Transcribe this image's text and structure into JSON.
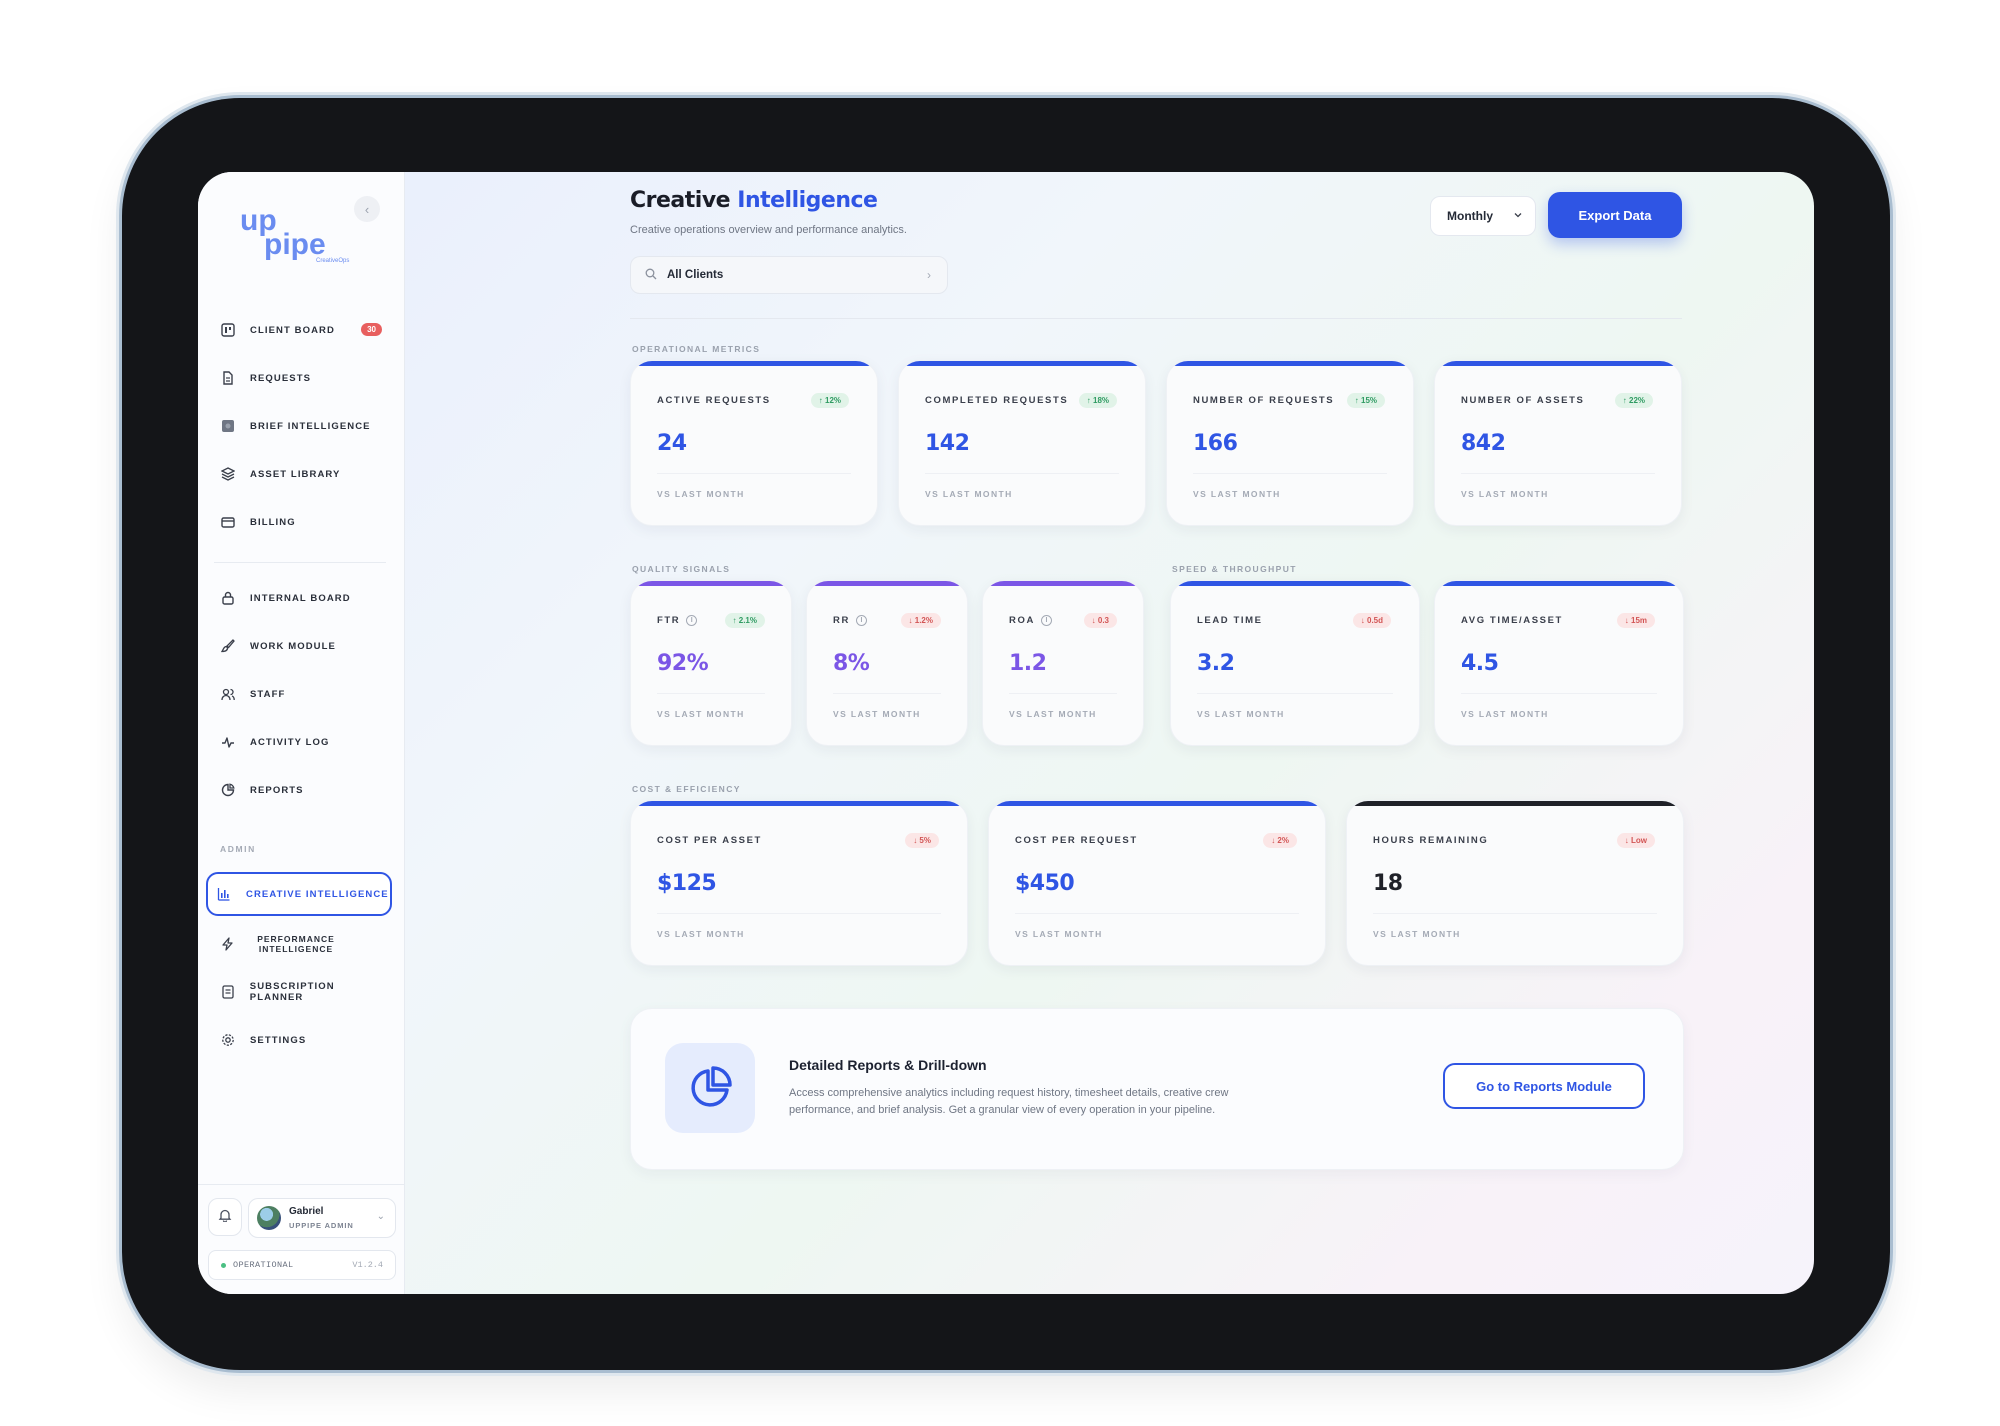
{
  "brand": {
    "logo_top": "up",
    "logo_bottom": "pipe",
    "tagline": "CreativeOps",
    "accent": "#2f55e4"
  },
  "sidebar": {
    "collapse_label": "‹",
    "items": [
      {
        "label": "CLIENT BOARD",
        "badge": "30",
        "icon": "kanban-icon"
      },
      {
        "label": "REQUESTS",
        "icon": "document-icon"
      },
      {
        "label": "BRIEF INTELLIGENCE",
        "icon": "brief-icon"
      },
      {
        "label": "ASSET LIBRARY",
        "icon": "layers-icon"
      },
      {
        "label": "BILLING",
        "icon": "card-icon"
      },
      {
        "label": "INTERNAL BOARD",
        "icon": "lock-icon"
      },
      {
        "label": "WORK MODULE",
        "icon": "brush-icon"
      },
      {
        "label": "STAFF",
        "icon": "users-icon"
      },
      {
        "label": "ACTIVITY LOG",
        "icon": "pulse-icon"
      },
      {
        "label": "REPORTS",
        "icon": "pie-icon"
      }
    ],
    "admin_label": "ADMIN",
    "admin_items": [
      {
        "label": "CREATIVE INTELLIGENCE",
        "icon": "bar-chart-icon",
        "active": true
      },
      {
        "label": "PERFORMANCE INTELLIGENCE",
        "icon": "bolt-icon"
      },
      {
        "label": "SUBSCRIPTION PLANNER",
        "icon": "planner-icon"
      },
      {
        "label": "SETTINGS",
        "icon": "gear-icon"
      }
    ],
    "user": {
      "name": "Gabriel",
      "role": "UPPIPE ADMIN"
    },
    "status": {
      "text": "OPERATIONAL",
      "version": "V1.2.4",
      "color": "#4bbf83"
    }
  },
  "header": {
    "title_part1": "Creative",
    "title_part2": "Intelligence",
    "subtitle": "Creative operations overview and performance analytics.",
    "client_filter": "All Clients",
    "period": "Monthly",
    "export_label": "Export Data"
  },
  "sections": {
    "operational": "OPERATIONAL METRICS",
    "quality": "QUALITY SIGNALS",
    "speed": "SPEED & THROUGHPUT",
    "cost": "COST & EFFICIENCY"
  },
  "footer_label": "VS LAST MONTH",
  "operational_cards": [
    {
      "label": "ACTIVE REQUESTS",
      "value": "24",
      "delta": "↑ 12%"
    },
    {
      "label": "COMPLETED REQUESTS",
      "value": "142",
      "delta": "↑ 18%"
    },
    {
      "label": "NUMBER OF REQUESTS",
      "value": "166",
      "delta": "↑ 15%"
    },
    {
      "label": "NUMBER OF ASSETS",
      "value": "842",
      "delta": "↑ 22%"
    }
  ],
  "quality_cards": [
    {
      "label": "FTR",
      "value": "92%",
      "delta": "↑ 2.1%"
    },
    {
      "label": "RR",
      "value": "8%",
      "delta": "↓ 1.2%"
    },
    {
      "label": "ROA",
      "value": "1.2",
      "delta": "↓ 0.3"
    }
  ],
  "speed_cards": [
    {
      "label": "LEAD TIME",
      "value": "3.2",
      "delta": "↓ 0.5d"
    },
    {
      "label": "AVG TIME/ASSET",
      "value": "4.5",
      "delta": "↓ 15m"
    }
  ],
  "cost_cards": [
    {
      "label": "COST PER ASSET",
      "value": "$125",
      "delta": "↓ 5%"
    },
    {
      "label": "COST PER REQUEST",
      "value": "$450",
      "delta": "↓ 2%"
    },
    {
      "label": "HOURS REMAINING",
      "value": "18",
      "delta": "↓ Low"
    }
  ],
  "promo": {
    "title": "Detailed Reports & Drill-down",
    "description": "Access comprehensive analytics including request history, timesheet details, creative crew performance, and brief analysis. Get a granular view of every operation in your pipeline.",
    "button": "Go to Reports Module"
  }
}
